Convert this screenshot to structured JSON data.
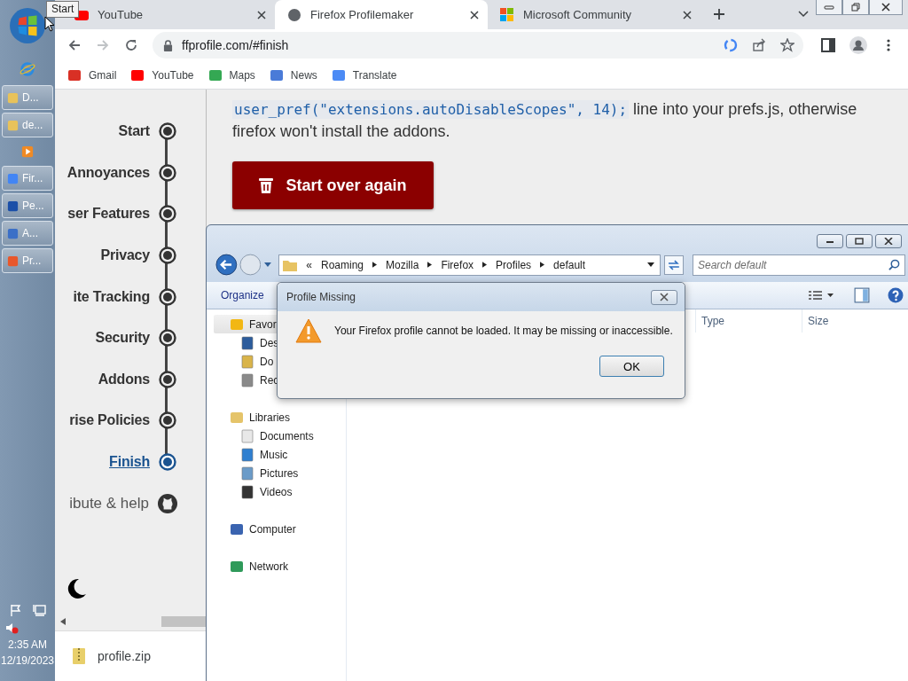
{
  "tooltip": {
    "text": "Start"
  },
  "taskbar": {
    "items": [
      {
        "kind": "download",
        "label": "D..."
      },
      {
        "kind": "folder",
        "label": "de..."
      },
      {
        "kind": "media"
      },
      {
        "kind": "chrome",
        "label": "Fir..."
      },
      {
        "kind": "monitor",
        "label": "Pe..."
      },
      {
        "kind": "picture",
        "label": "A..."
      },
      {
        "kind": "firefox",
        "label": "Pr..."
      }
    ],
    "time": "2:35 AM",
    "date": "12/19/2023"
  },
  "browser": {
    "tabs": [
      {
        "kind": "youtube",
        "title": "YouTube",
        "selected": false
      },
      {
        "kind": "globe",
        "title": "Firefox Profilemaker",
        "selected": true
      },
      {
        "kind": "microsoft",
        "title": "Microsoft Community",
        "selected": false
      }
    ],
    "address": "ffprofile.com/#finish",
    "bookmarks": [
      {
        "kind": "gmail",
        "label": "Gmail"
      },
      {
        "kind": "youtube",
        "label": "YouTube"
      },
      {
        "kind": "maps",
        "label": "Maps"
      },
      {
        "kind": "news",
        "label": "News"
      },
      {
        "kind": "translate",
        "label": "Translate"
      }
    ]
  },
  "page": {
    "nav": [
      {
        "label": "Start",
        "selected": false
      },
      {
        "label": "Annoyances",
        "selected": false
      },
      {
        "label": "ser Features",
        "selected": false
      },
      {
        "label": "Privacy",
        "selected": false
      },
      {
        "label": "ite Tracking",
        "selected": false
      },
      {
        "label": "Security",
        "selected": false
      },
      {
        "label": "Addons",
        "selected": false
      },
      {
        "label": "rise Policies",
        "selected": false
      },
      {
        "label": "Finish",
        "selected": true
      }
    ],
    "help": "ibute & help",
    "code": "user_pref(\"extensions.autoDisableScopes\", 14);",
    "text": "line into your prefs.js, otherwise firefox won't install the addons.",
    "button": "Start over again",
    "download": "profile.zip"
  },
  "explorer": {
    "overflow_mark": "«",
    "path": [
      "Roaming",
      "Mozilla",
      "Firefox",
      "Profiles",
      "default"
    ],
    "search": {
      "placeholder": "Search default"
    },
    "organize": "Organize",
    "columns": [
      "Type",
      "Size"
    ],
    "tree": [
      {
        "kind": "star",
        "label": "Favor",
        "selected": true,
        "children": [
          {
            "kind": "desktop",
            "label": "Des",
            "selected": false
          },
          {
            "kind": "download",
            "label": "Do",
            "selected": false
          },
          {
            "kind": "recent",
            "label": "Rec",
            "selected": false
          }
        ]
      },
      {
        "kind": "library",
        "label": "Libraries",
        "selected": false,
        "children": [
          {
            "kind": "document",
            "label": "Documents",
            "selected": false
          },
          {
            "kind": "music",
            "label": "Music",
            "selected": false
          },
          {
            "kind": "picture",
            "label": "Pictures",
            "selected": false
          },
          {
            "kind": "video",
            "label": "Videos",
            "selected": false
          }
        ]
      },
      {
        "kind": "computer",
        "label": "Computer",
        "selected": false
      },
      {
        "kind": "network",
        "label": "Network",
        "selected": false
      }
    ]
  },
  "dialog": {
    "title": "Profile Missing",
    "message": "Your Firefox profile cannot be loaded. It may be missing or inaccessible.",
    "button": "OK"
  }
}
